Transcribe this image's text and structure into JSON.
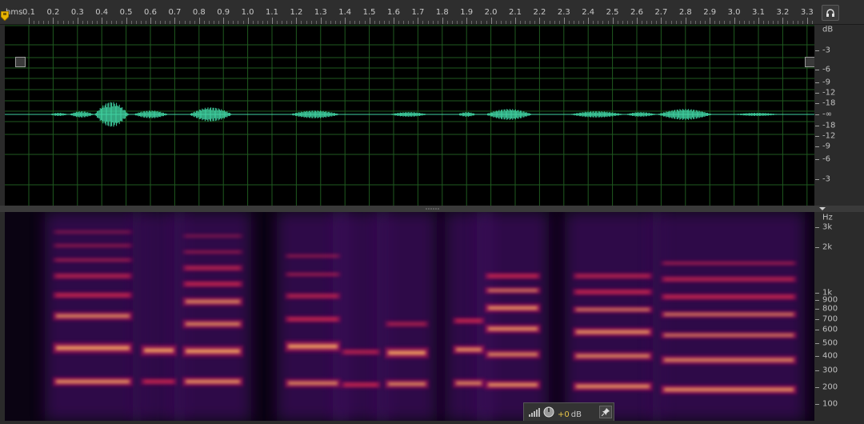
{
  "ruler": {
    "unit": "hms",
    "ticks": [
      "0.1",
      "0.2",
      "0.3",
      "0.4",
      "0.5",
      "0.6",
      "0.7",
      "0.8",
      "0.9",
      "1.0",
      "1.1",
      "1.2",
      "1.3",
      "1.4",
      "1.5",
      "1.6",
      "1.7",
      "1.8",
      "1.9",
      "2.0",
      "2.1",
      "2.2",
      "2.3",
      "2.4",
      "2.5",
      "2.6",
      "2.7",
      "2.8",
      "2.9",
      "3.0",
      "3.1",
      "3.2",
      "3.3"
    ]
  },
  "waveform": {
    "db_unit": "dB",
    "db_labels": [
      "-3",
      "-6",
      "-9",
      "-12",
      "-18",
      "-∞",
      "-18",
      "-12",
      "-9",
      "-6",
      "-3"
    ],
    "color": "#3fd1a0",
    "grid_color": "#1f5a1f"
  },
  "spectrogram": {
    "hz_unit": "Hz",
    "hz_labels": [
      "3k",
      "2k",
      "1k",
      "900",
      "800",
      "700",
      "600",
      "500",
      "400",
      "300",
      "200",
      "100"
    ]
  },
  "bottom_bar": {
    "gain_value": "+0",
    "gain_unit": "dB"
  },
  "icons": {
    "headphones": "headphones-icon",
    "level_meter": "level-meter-icon",
    "gain_knob": "knob-icon",
    "pin": "pin-icon",
    "playhead": "playhead-marker-icon"
  }
}
